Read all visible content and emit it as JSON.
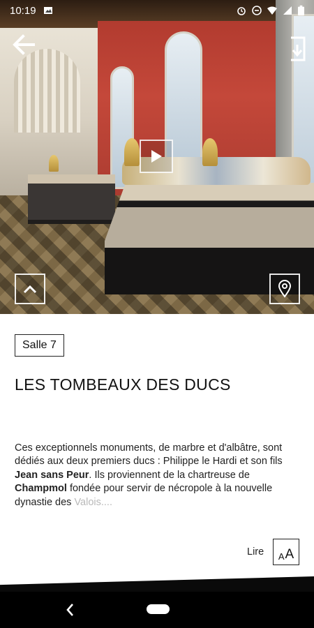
{
  "status_bar": {
    "time": "10:19",
    "icons": [
      "image-icon",
      "alarm-icon",
      "do-not-disturb-icon",
      "wifi-icon",
      "signal-icon",
      "battery-icon"
    ]
  },
  "hero": {
    "controls": {
      "back": "back-arrow-icon",
      "exit": "exit-icon",
      "play": "play-icon",
      "collapse": "chevron-up-icon",
      "map": "location-pin-icon"
    }
  },
  "content": {
    "room_label": "Salle 7",
    "title": "LES TOMBEAUX DES DUCS",
    "description": {
      "p1": "Ces exceptionnels monuments, de marbre et d'albâtre, sont dédiés aux deux premiers ducs : Philippe le Hardi et son fils ",
      "b1": "Jean sans Peur",
      "p2": ". Ils proviennent de la chartreuse de ",
      "b2": "Champmol",
      "p3": " fondée pour servir de nécropole à la nouvelle dynastie des ",
      "fade": "Valois...."
    },
    "read_label": "Lire",
    "font_button_small": "A",
    "font_button_big": "A"
  },
  "colors": {
    "nav_bar": "#000000",
    "text": "#111111",
    "fade_text": "#b9b9b9"
  }
}
